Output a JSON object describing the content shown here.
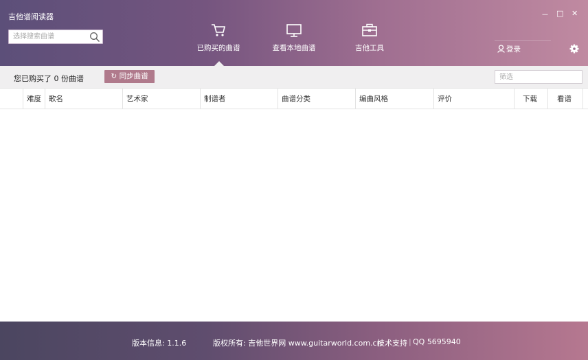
{
  "app": {
    "title": "吉他谱阅读器"
  },
  "window_controls": {
    "minimize": "－",
    "maximize": "□",
    "close": "✕"
  },
  "search": {
    "placeholder": "选择搜索曲谱"
  },
  "nav": {
    "items": [
      {
        "label": "已购买的曲谱",
        "icon": "shopping-cart-icon",
        "active": true
      },
      {
        "label": "查看本地曲谱",
        "icon": "monitor-icon",
        "active": false
      },
      {
        "label": "吉他工具",
        "icon": "toolbox-icon",
        "active": false
      }
    ]
  },
  "user": {
    "login_label": "登录"
  },
  "toolbar": {
    "purchase_count_text": "您已购买了 0 份曲谱",
    "sync_label": "同步曲谱",
    "filter_placeholder": "筛选"
  },
  "table": {
    "columns": [
      "难度",
      "歌名",
      "艺术家",
      "制谱者",
      "曲谱分类",
      "编曲风格",
      "评价",
      "下载",
      "看谱"
    ],
    "rows": []
  },
  "footer": {
    "version": "版本信息: 1.1.6",
    "copyright": "版权所有: 吉他世界网 www.guitarworld.com.cn",
    "support": "技术支持",
    "divider": "|",
    "qq": "QQ 5695940"
  },
  "colors": {
    "header_start": "#5c4f79",
    "header_end": "#c08aa1",
    "accent_button": "#b07a8c",
    "toolbar_bg": "#f0eff0"
  }
}
